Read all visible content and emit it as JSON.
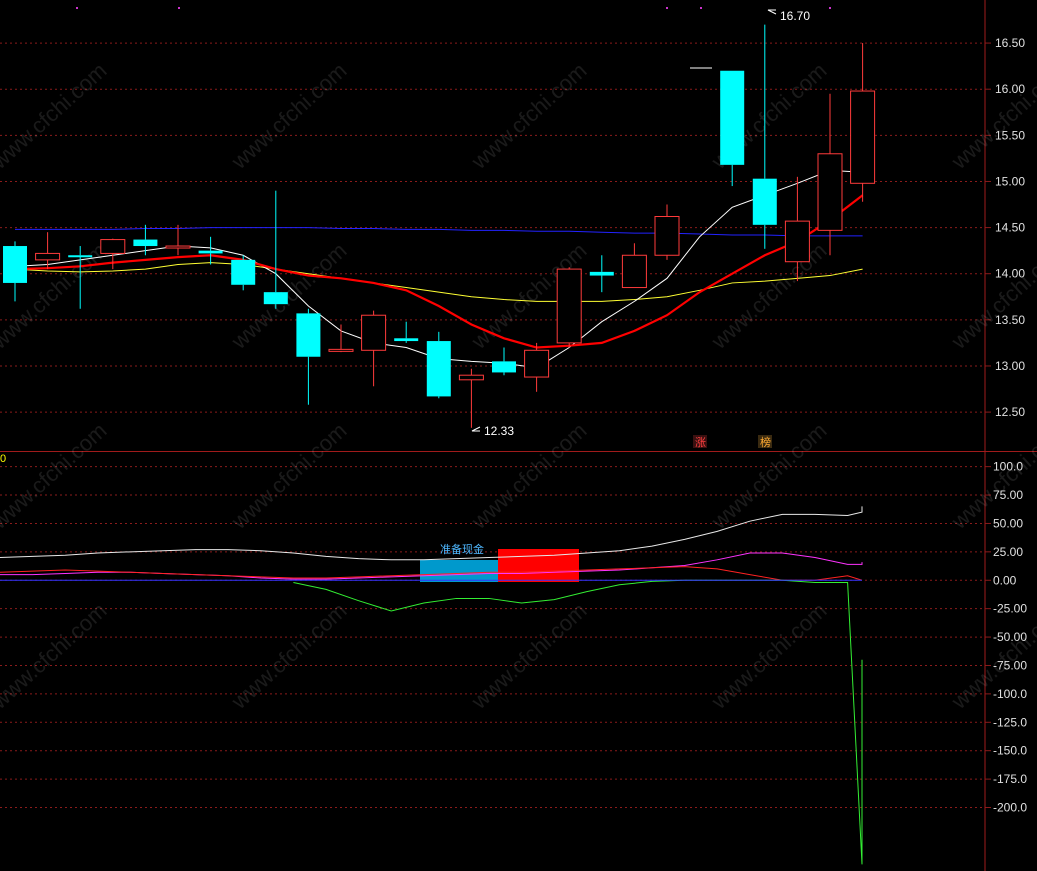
{
  "watermark": "www.cfchi.com",
  "price_panel": {
    "y_ticks": [
      "16.50",
      "16.00",
      "15.50",
      "15.00",
      "14.50",
      "14.00",
      "13.50",
      "13.00",
      "12.50"
    ],
    "high_label": "16.70",
    "low_label": "12.33",
    "badges": [
      {
        "text": "涨",
        "color": "#ff4040"
      },
      {
        "text": "榜",
        "color": "#ffaa33"
      }
    ]
  },
  "indicator_panel": {
    "zero_label": "0",
    "y_ticks": [
      "100.0",
      "75.00",
      "50.00",
      "25.00",
      "0.00",
      "-25.00",
      "-50.00",
      "-75.00",
      "-100.0",
      "-125.0",
      "-150.0",
      "-175.0",
      "-200.0"
    ],
    "cash_label": "准备现金"
  },
  "colors": {
    "up": "#ff3b3b",
    "down": "#00ffff",
    "ma5": "#ffffff",
    "ma10": "#ff0000",
    "ma20": "#ffff33",
    "ma60": "#2222ff",
    "grid": "#8a1b1b",
    "cash_blue": "#0099cc",
    "cash_red": "#ff0000"
  },
  "chart_data": [
    {
      "type": "candlestick",
      "ylim": [
        12.1,
        16.75
      ],
      "candles": [
        {
          "o": 14.3,
          "h": 14.35,
          "l": 13.7,
          "c": 13.9
        },
        {
          "o": 14.15,
          "h": 14.45,
          "l": 14.05,
          "c": 14.22
        },
        {
          "o": 14.2,
          "h": 14.3,
          "l": 13.62,
          "c": 14.18
        },
        {
          "o": 14.22,
          "h": 14.38,
          "l": 14.05,
          "c": 14.37
        },
        {
          "o": 14.37,
          "h": 14.53,
          "l": 14.2,
          "c": 14.3
        },
        {
          "o": 14.28,
          "h": 14.53,
          "l": 14.2,
          "c": 14.3
        },
        {
          "o": 14.25,
          "h": 14.4,
          "l": 14.1,
          "c": 14.22
        },
        {
          "o": 14.15,
          "h": 14.2,
          "l": 13.82,
          "c": 13.88
        },
        {
          "o": 13.8,
          "h": 14.9,
          "l": 13.62,
          "c": 13.67
        },
        {
          "o": 13.57,
          "h": 13.62,
          "l": 12.58,
          "c": 13.1
        },
        {
          "o": 13.18,
          "h": 13.45,
          "l": 13.15,
          "c": 13.18
        },
        {
          "o": 13.17,
          "h": 13.6,
          "l": 12.78,
          "c": 13.55
        },
        {
          "o": 13.3,
          "h": 13.48,
          "l": 13.25,
          "c": 13.27
        },
        {
          "o": 13.27,
          "h": 13.37,
          "l": 12.65,
          "c": 12.67
        },
        {
          "o": 12.85,
          "h": 12.97,
          "l": 12.33,
          "c": 12.9
        },
        {
          "o": 13.05,
          "h": 13.2,
          "l": 12.9,
          "c": 12.93
        },
        {
          "o": 12.88,
          "h": 13.25,
          "l": 12.72,
          "c": 13.17
        },
        {
          "o": 13.25,
          "h": 14.07,
          "l": 13.2,
          "c": 14.05
        },
        {
          "o": 14.02,
          "h": 14.2,
          "l": 13.8,
          "c": 13.98
        },
        {
          "o": 13.85,
          "h": 14.33,
          "l": 13.85,
          "c": 14.2
        },
        {
          "o": 14.2,
          "h": 14.75,
          "l": 14.15,
          "c": 14.62
        },
        {
          "o": null,
          "h": null,
          "l": null,
          "c": null
        },
        {
          "o": 16.2,
          "h": 16.2,
          "l": 14.95,
          "c": 15.18
        },
        {
          "o": 15.03,
          "h": 16.7,
          "l": 14.27,
          "c": 14.53
        },
        {
          "o": 14.13,
          "h": 15.05,
          "l": 13.92,
          "c": 14.57
        },
        {
          "o": 14.47,
          "h": 15.95,
          "l": 14.2,
          "c": 15.3
        },
        {
          "o": 14.98,
          "h": 16.5,
          "l": 14.78,
          "c": 15.98
        }
      ],
      "ma5": [
        14.08,
        14.1,
        14.15,
        14.2,
        14.25,
        14.3,
        14.28,
        14.2,
        14.0,
        13.65,
        13.38,
        13.25,
        13.2,
        13.08,
        13.05,
        13.03,
        12.98,
        13.2,
        13.48,
        13.7,
        13.95,
        14.4,
        14.72,
        14.85,
        14.98,
        15.12,
        15.1
      ],
      "ma10": [
        14.05,
        14.06,
        14.08,
        14.12,
        14.15,
        14.18,
        14.2,
        14.15,
        14.05,
        13.98,
        13.95,
        13.9,
        13.82,
        13.65,
        13.45,
        13.3,
        13.2,
        13.22,
        13.25,
        13.38,
        13.55,
        13.8,
        14.0,
        14.2,
        14.35,
        14.58,
        14.85
      ],
      "ma20": [
        14.05,
        14.03,
        14.02,
        14.03,
        14.05,
        14.1,
        14.12,
        14.1,
        14.05,
        14.0,
        13.95,
        13.9,
        13.85,
        13.8,
        13.75,
        13.72,
        13.7,
        13.7,
        13.7,
        13.72,
        13.75,
        13.82,
        13.9,
        13.92,
        13.95,
        13.98,
        14.05
      ],
      "ma60": [
        14.48,
        14.48,
        14.48,
        14.48,
        14.49,
        14.49,
        14.5,
        14.5,
        14.5,
        14.5,
        14.49,
        14.49,
        14.48,
        14.48,
        14.47,
        14.47,
        14.46,
        14.46,
        14.45,
        14.44,
        14.44,
        14.43,
        14.42,
        14.42,
        14.41,
        14.41,
        14.41
      ]
    },
    {
      "type": "line",
      "ylim": [
        -255,
        112
      ],
      "series": [
        {
          "key": "white",
          "color": "#e8e8e8",
          "values": [
            20,
            21,
            22,
            24,
            25,
            26,
            27,
            27,
            26,
            24,
            21,
            19,
            18,
            18,
            19,
            20,
            21,
            22,
            24,
            26,
            30,
            36,
            43,
            52,
            58,
            58,
            57,
            60,
            65
          ]
        },
        {
          "key": "magenta",
          "color": "#ff33ff",
          "values": [
            5,
            5,
            6,
            7,
            7,
            6,
            5,
            4,
            2,
            1,
            1,
            2,
            3,
            4,
            5,
            6,
            6,
            7,
            8,
            9,
            11,
            13,
            18,
            24,
            24,
            20,
            14,
            14,
            16
          ]
        },
        {
          "key": "red",
          "color": "#ff2222",
          "values": [
            7,
            8,
            9,
            8,
            7,
            6,
            5,
            4,
            3,
            2,
            2,
            3,
            4,
            5,
            6,
            7,
            7,
            8,
            9,
            10,
            11,
            12,
            10,
            5,
            0,
            0,
            4,
            0,
            null
          ]
        },
        {
          "key": "green",
          "color": "#33ee33",
          "values": [
            null,
            null,
            null,
            null,
            null,
            null,
            null,
            null,
            null,
            -2,
            -8,
            -18,
            -27,
            -20,
            -16,
            -16,
            -20,
            -17,
            -10,
            -4,
            -1,
            0,
            0,
            0,
            0,
            -2,
            -2,
            -250,
            -70
          ]
        },
        {
          "key": "blue",
          "color": "#3333ff",
          "values": [
            0,
            0,
            0,
            0,
            0,
            0,
            0,
            0,
            0,
            0,
            0,
            0,
            0,
            0,
            0,
            0,
            0,
            0,
            0,
            0,
            0,
            0,
            0,
            0,
            0,
            0,
            0,
            0,
            0
          ]
        }
      ]
    }
  ]
}
